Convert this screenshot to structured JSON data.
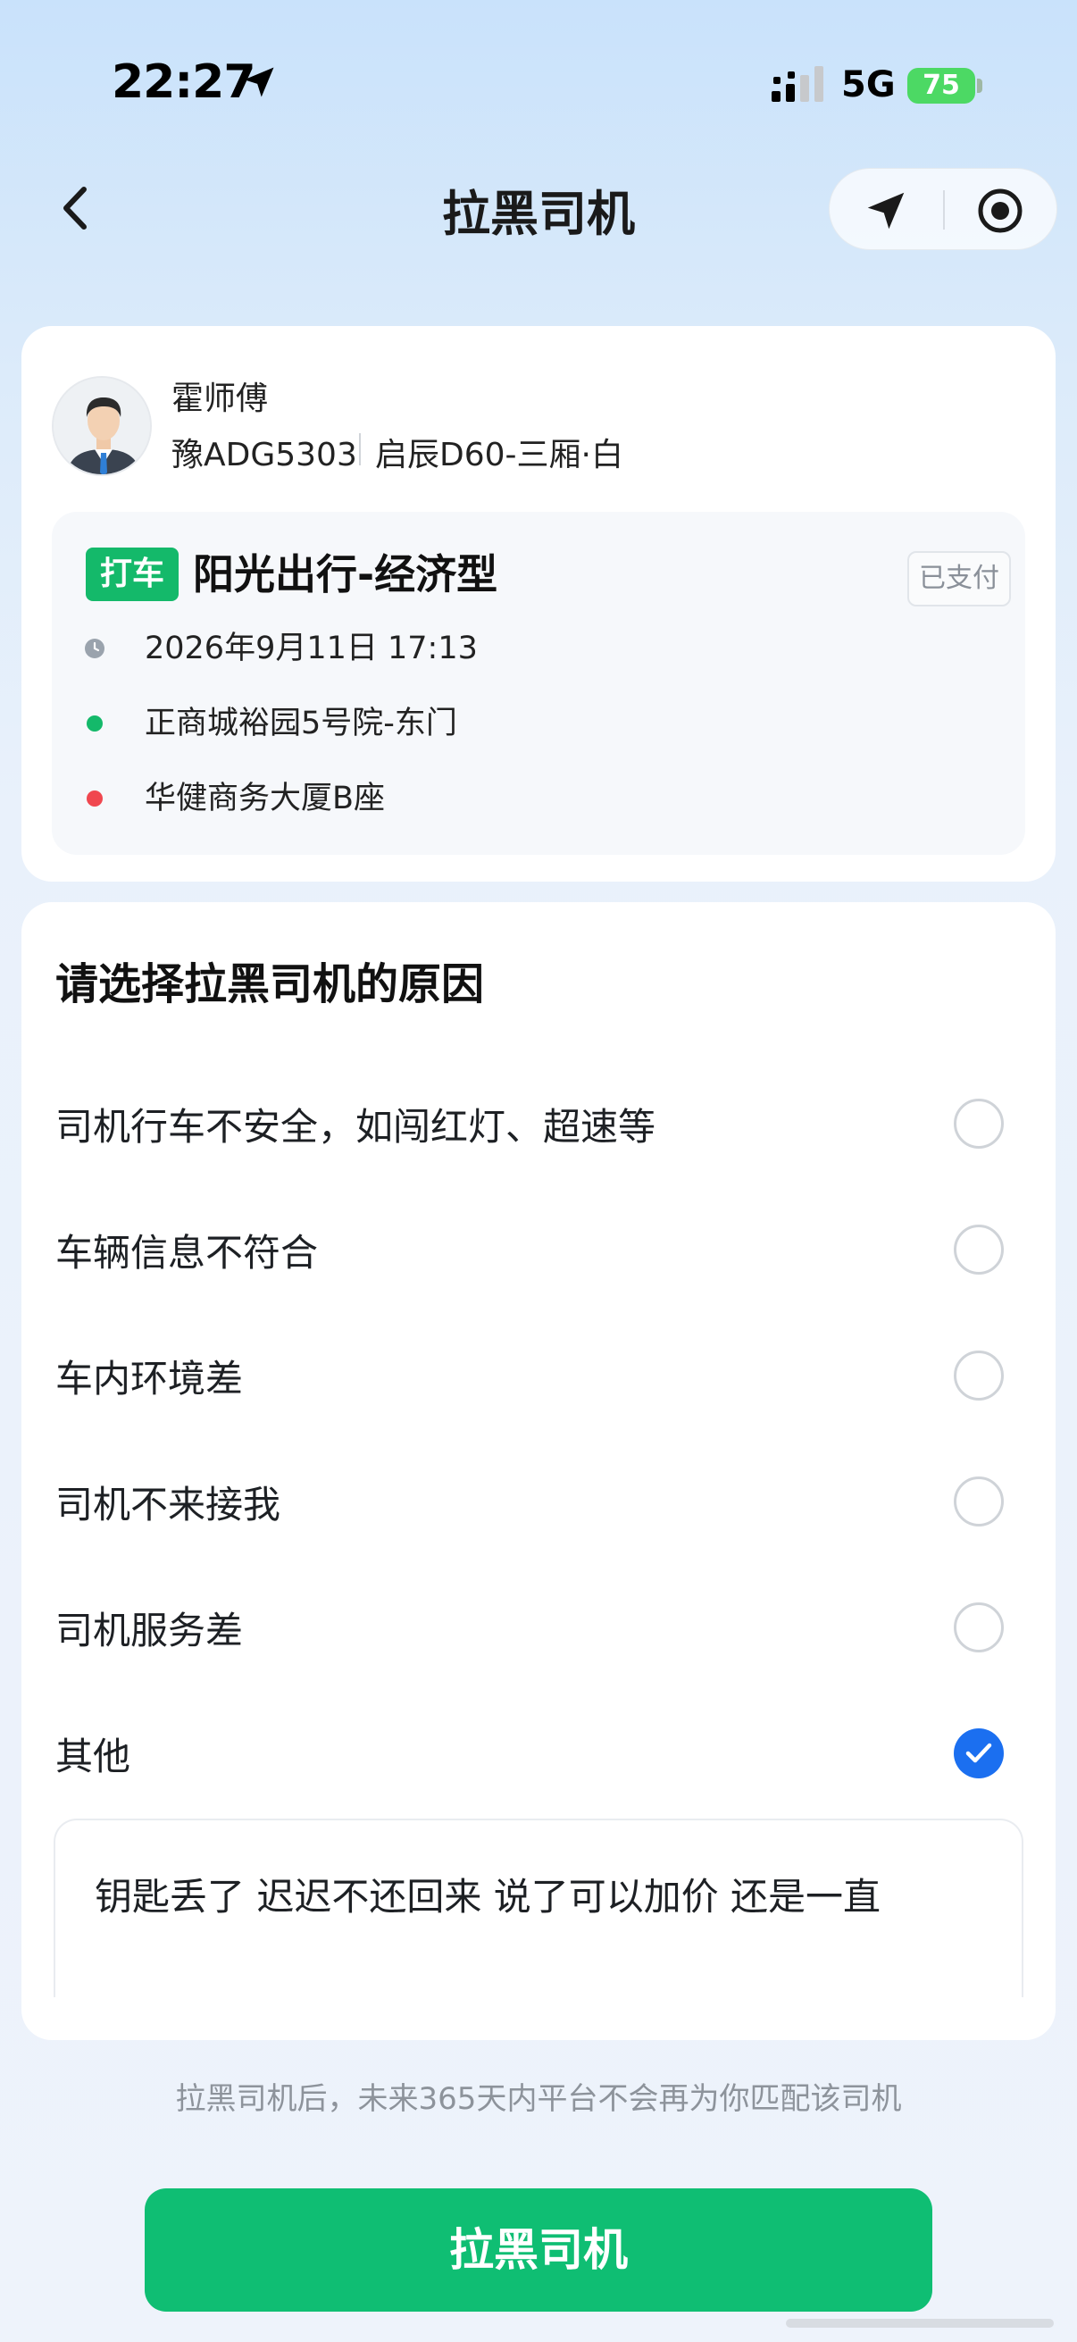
{
  "status_bar": {
    "time": "22:27",
    "network": "5G",
    "battery": "75"
  },
  "nav": {
    "title": "拉黑司机"
  },
  "driver": {
    "name": "霍师傅",
    "plate": "豫ADG5303",
    "car": "启辰D60-三厢·白"
  },
  "trip": {
    "tag": "打车",
    "service": "阳光出行-经济型",
    "status": "已支付",
    "datetime": "2026年9月11日 17:13",
    "from": "正商城裕园5号院-东门",
    "to": "华健商务大厦B座"
  },
  "reasons": {
    "heading": "请选择拉黑司机的原因",
    "options": [
      {
        "label": "司机行车不安全，如闯红灯、超速等",
        "checked": false
      },
      {
        "label": "车辆信息不符合",
        "checked": false
      },
      {
        "label": "车内环境差",
        "checked": false
      },
      {
        "label": "司机不来接我",
        "checked": false
      },
      {
        "label": "司机服务差",
        "checked": false
      },
      {
        "label": "其他",
        "checked": true
      }
    ],
    "other_text": "钥匙丢了 迟迟不还回来 说了可以加价 还是一直"
  },
  "footer_note": "拉黑司机后，未来365天内平台不会再为你匹配该司机",
  "submit_label": "拉黑司机",
  "colors": {
    "primary_green": "#0fbe73",
    "check_blue": "#1b6ff0",
    "start_dot": "#14b96a",
    "end_dot": "#f0474f"
  }
}
